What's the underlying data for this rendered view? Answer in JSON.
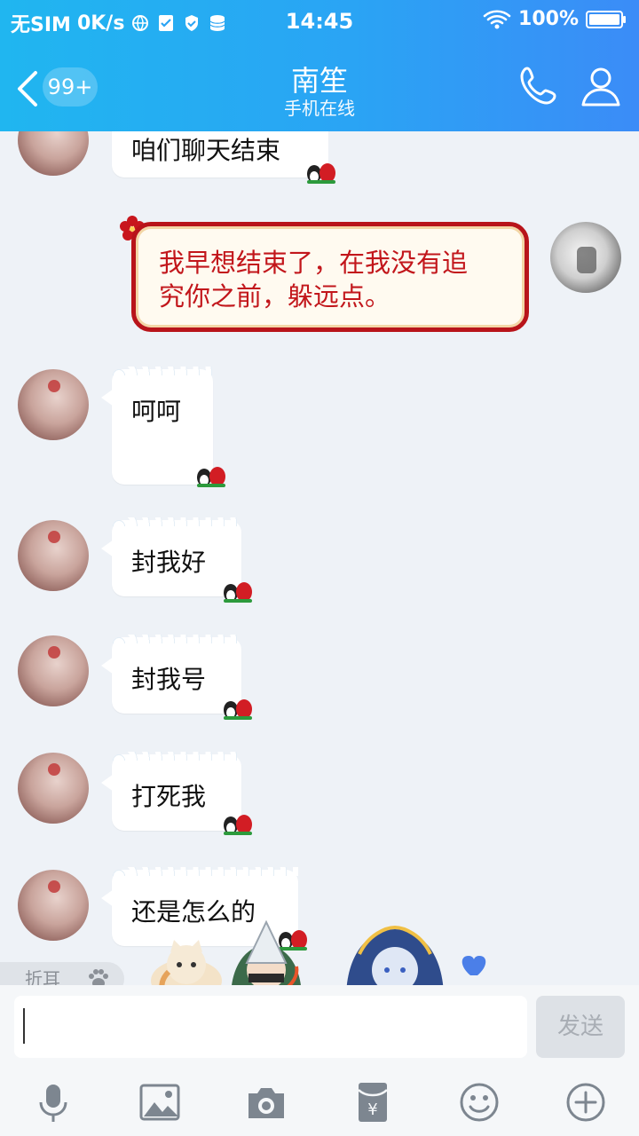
{
  "status_bar": {
    "carrier": "无SIM",
    "speed": "0K/s",
    "time": "14:45",
    "battery": "100%",
    "icons": [
      "globe-icon",
      "check-icon",
      "shield-icon",
      "database-icon",
      "wifi-icon",
      "battery-icon"
    ]
  },
  "header": {
    "back_badge": "99+",
    "title": "南笙",
    "subtitle": "手机在线",
    "icons": [
      "back-chevron-icon",
      "phone-icon",
      "profile-icon"
    ]
  },
  "messages": [
    {
      "sender": "other",
      "text": "咱们聊天结束"
    },
    {
      "sender": "me",
      "text_line1": "我早想结束了，在我没有追",
      "text_line2": "究你之前，躲远点。"
    },
    {
      "sender": "other",
      "text": "呵呵"
    },
    {
      "sender": "other",
      "text": "封我好"
    },
    {
      "sender": "other",
      "text": "封我号"
    },
    {
      "sender": "other",
      "text": "打死我"
    },
    {
      "sender": "other",
      "text": "还是怎么的"
    }
  ],
  "fold_label": "折耳",
  "input": {
    "value": "",
    "send_label": "发送"
  },
  "toolbar": [
    "mic-icon",
    "image-icon",
    "camera-icon",
    "red-packet-icon",
    "emoji-icon",
    "plus-icon"
  ],
  "colors": {
    "header_start": "#20b6f0",
    "header_end": "#3b8cf7",
    "accent_red": "#c2161b",
    "background": "#eef2f7"
  }
}
